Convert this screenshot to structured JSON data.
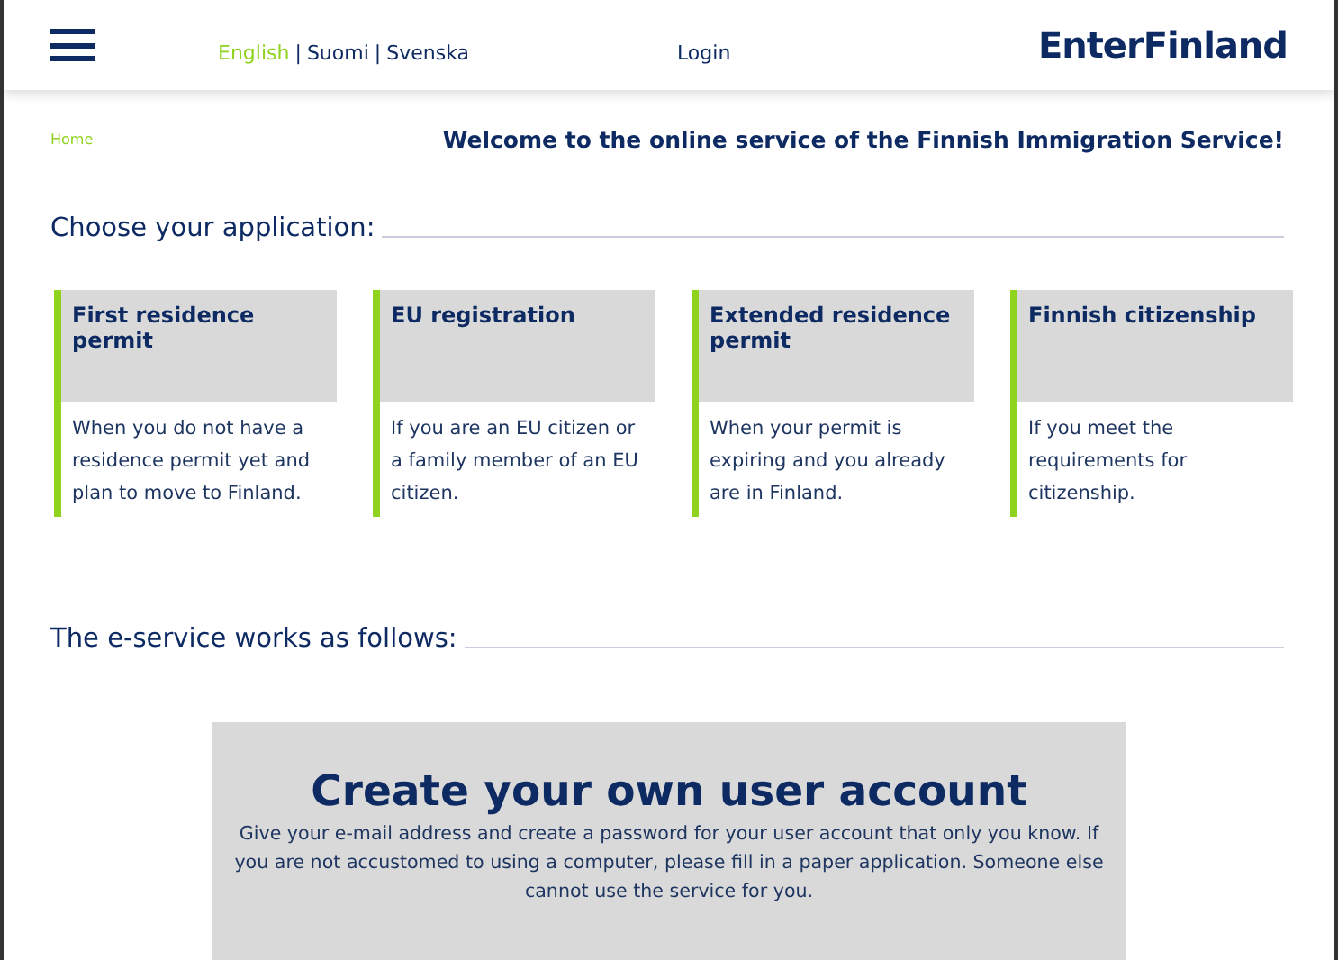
{
  "header": {
    "languages": [
      {
        "label": "English",
        "selected": true
      },
      {
        "label": "Suomi",
        "selected": false
      },
      {
        "label": "Svenska",
        "selected": false
      }
    ],
    "separator": "|",
    "login": "Login",
    "logo": "EnterFinland"
  },
  "breadcrumb": "Home",
  "welcome": "Welcome to the online service of the Finnish Immigration Service!",
  "applications": {
    "heading": "Choose your application:",
    "cards": [
      {
        "title": "First residence permit",
        "text": "When you do not have a residence permit yet and plan to move to Finland."
      },
      {
        "title": "EU registration",
        "text": "If you are an EU citizen or a family member of an EU citizen."
      },
      {
        "title": "Extended residence permit",
        "text": "When your permit is expiring and you already are in Finland."
      },
      {
        "title": "Finnish citizenship",
        "text": "If you meet the requirements for citizenship."
      }
    ]
  },
  "how_it_works": {
    "heading": "The e-service works as follows:",
    "step": {
      "title": "Create your own user account",
      "text": "Give your e-mail address and create a password for your user account that only you know. If you are not accustomed to using a computer, please fill in a paper application. Someone else cannot use the service for you."
    }
  }
}
